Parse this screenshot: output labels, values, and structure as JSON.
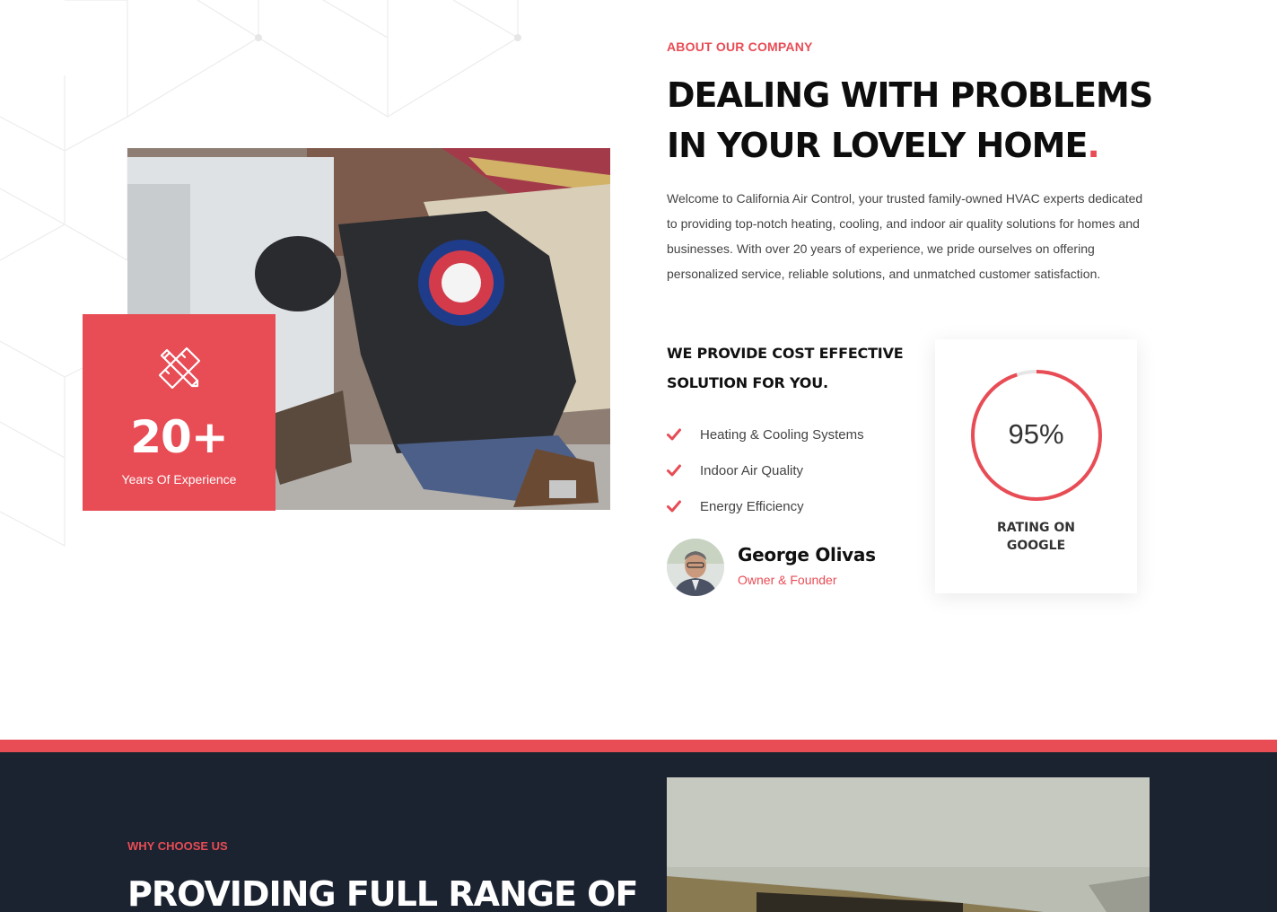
{
  "about": {
    "eyebrow": "ABOUT OUR COMPANY",
    "heading_line1": "DEALING WITH PROBLEMS",
    "heading_line2": "IN YOUR LOVELY HOME",
    "heading_dot": ".",
    "intro": "Welcome to California Air Control, your trusted family-owned HVAC experts dedicated to providing top-notch heating, cooling, and indoor air quality solutions for homes and businesses. With over 20 years of experience, we pride ourselves on offering personalized service, reliable solutions, and unmatched customer satisfaction.",
    "subheading": "WE PROVIDE COST EFFECTIVE SOLUTION FOR YOU.",
    "features": [
      {
        "label": "Heating & Cooling Systems",
        "icon": "check-icon"
      },
      {
        "label": "Indoor Air Quality",
        "icon": "check-icon"
      },
      {
        "label": "Energy Efficiency",
        "icon": "check-icon"
      }
    ]
  },
  "experience": {
    "icon": "pencil-ruler-icon",
    "number": "20+",
    "label": "Years Of Experience"
  },
  "founder": {
    "name": "George Olivas",
    "title": "Owner & Founder"
  },
  "rating": {
    "value_text": "95%",
    "percent": 95,
    "label_line1": "RATING ON",
    "label_line2": "GOOGLE"
  },
  "why": {
    "eyebrow": "WHY CHOOSE US",
    "heading": "PROVIDING FULL RANGE OF"
  },
  "colors": {
    "accent": "#e84c55",
    "dark_section": "#1b2230",
    "heading": "#0d0d0d",
    "body_text": "#444444",
    "ring_track": "#e6e6e6"
  }
}
